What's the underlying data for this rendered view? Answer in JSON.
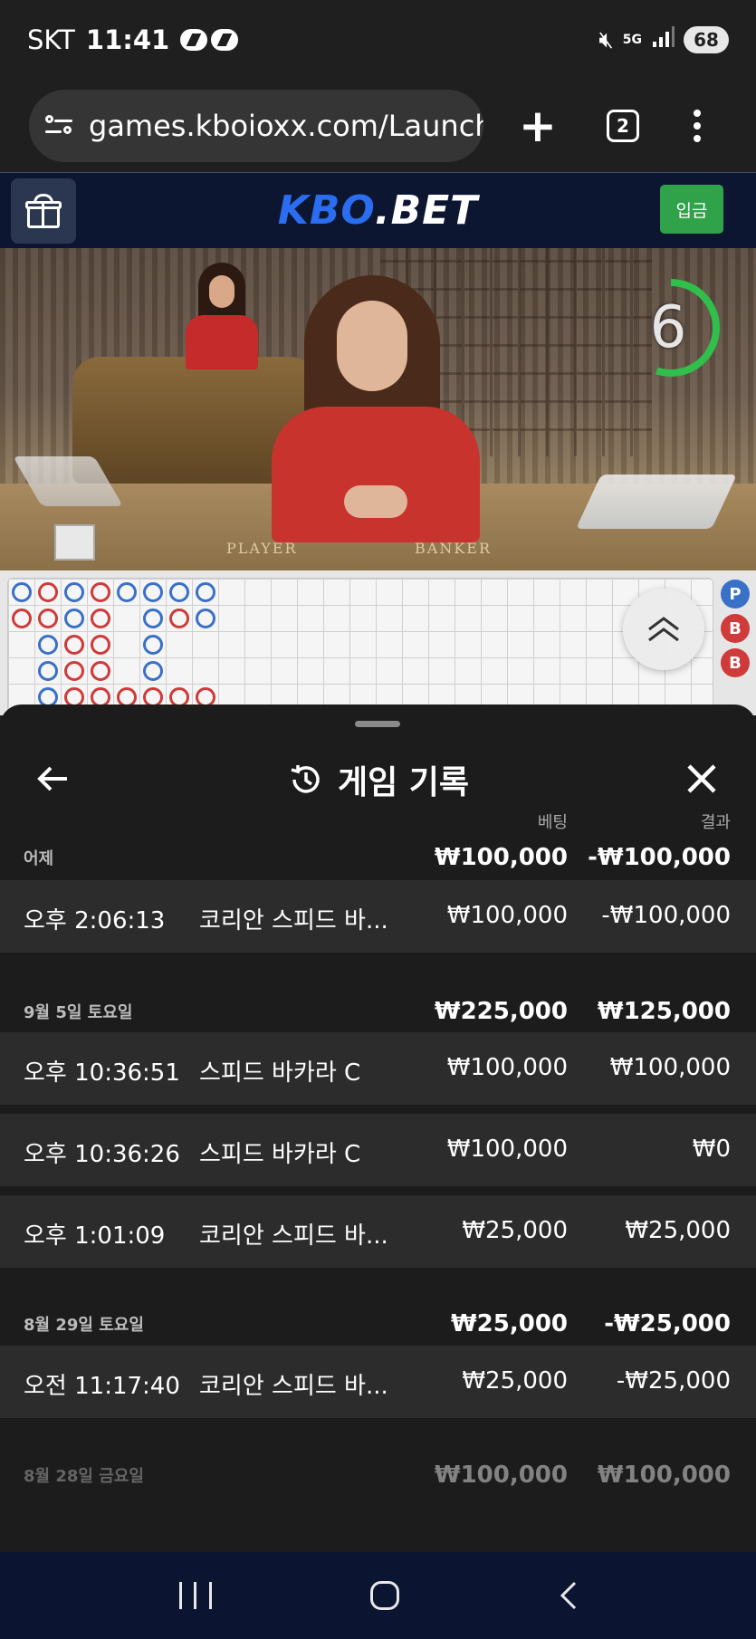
{
  "status_bar": {
    "carrier": "SKT",
    "time": "11:41",
    "network": "5G",
    "battery": "68"
  },
  "browser": {
    "url": "games.kboioxx.com/Launch(",
    "tab_count": "2"
  },
  "site": {
    "logo_kbo": "KBO",
    "logo_bet": ".BET",
    "deposit_label": "입금"
  },
  "video": {
    "timer": "6",
    "timer_fraction": 0.55,
    "table_player": "PLAYER",
    "table_banker": "BANKER"
  },
  "sidebar_bubbles": [
    "P",
    "B",
    "B"
  ],
  "history": {
    "title": "게임 기록",
    "col_bet": "베팅",
    "col_result": "결과",
    "groups": [
      {
        "label": "어제",
        "bet": "₩100,000",
        "result": "-₩100,000",
        "rows": [
          {
            "time": "오후 2:06:13",
            "game": "코리안 스피드 바...",
            "bet": "₩100,000",
            "result": "-₩100,000"
          }
        ]
      },
      {
        "label": "9월 5일 토요일",
        "bet": "₩225,000",
        "result": "₩125,000",
        "rows": [
          {
            "time": "오후 10:36:51",
            "game": "스피드 바카라 C",
            "bet": "₩100,000",
            "result": "₩100,000"
          },
          {
            "time": "오후 10:36:26",
            "game": "스피드 바카라 C",
            "bet": "₩100,000",
            "result": "₩0"
          },
          {
            "time": "오후 1:01:09",
            "game": "코리안 스피드 바...",
            "bet": "₩25,000",
            "result": "₩25,000"
          }
        ]
      },
      {
        "label": "8월 29일 토요일",
        "bet": "₩25,000",
        "result": "-₩25,000",
        "rows": [
          {
            "time": "오전 11:17:40",
            "game": "코리안 스피드 바...",
            "bet": "₩25,000",
            "result": "-₩25,000"
          }
        ]
      },
      {
        "label": "8월 28일 금요일",
        "bet": "₩100,000",
        "result": "₩100,000",
        "rows": []
      }
    ]
  },
  "colors": {
    "player_blue": "#3970c8",
    "banker_red": "#cf3a3a",
    "timer_green": "#2fbf4a",
    "deposit_green": "#2fa24a",
    "logo_blue": "#2a6df0"
  }
}
